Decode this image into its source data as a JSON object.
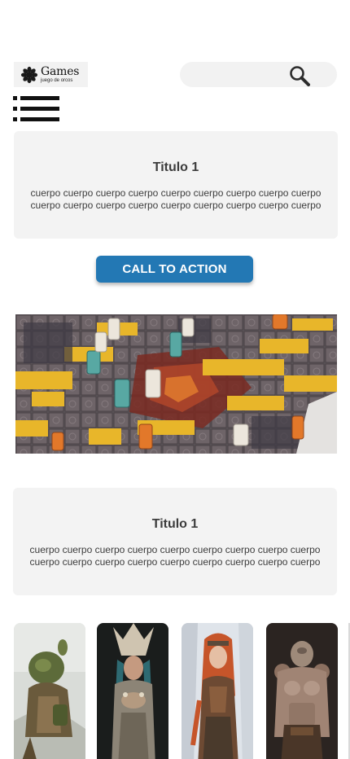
{
  "header": {
    "logo": {
      "title": "Games",
      "subtitle": "juego de orcos",
      "icon": "flower-emblem-icon"
    },
    "search": {
      "placeholder": "",
      "value": "",
      "icon": "search-icon"
    },
    "menu": {
      "icon": "list-menu-icon"
    }
  },
  "section1": {
    "title": "Titulo 1",
    "body": "cuerpo cuerpo cuerpo cuerpo cuerpo cuerpo  cuerpo cuerpo cuerpo cuerpo cuerpo cuerpo cuerpo cuerpo cuerpo cuerpo cuerpo cuerpo"
  },
  "cta": {
    "label": "CALL TO ACTION",
    "color": "#2378b4"
  },
  "hero_image": {
    "subject": "board-game-tabletop"
  },
  "section2": {
    "title": "Titulo 1",
    "body": "cuerpo cuerpo cuerpo cuerpo cuerpo cuerpo  cuerpo cuerpo cuerpo cuerpo cuerpo cuerpo cuerpo cuerpo cuerpo cuerpo cuerpo cuerpo"
  },
  "characters": [
    {
      "subject": "orc-warrior-crouching"
    },
    {
      "subject": "tribal-warrior-woman-headdress"
    },
    {
      "subject": "red-haired-warrior-woman"
    },
    {
      "subject": "armored-orc-brute"
    }
  ]
}
